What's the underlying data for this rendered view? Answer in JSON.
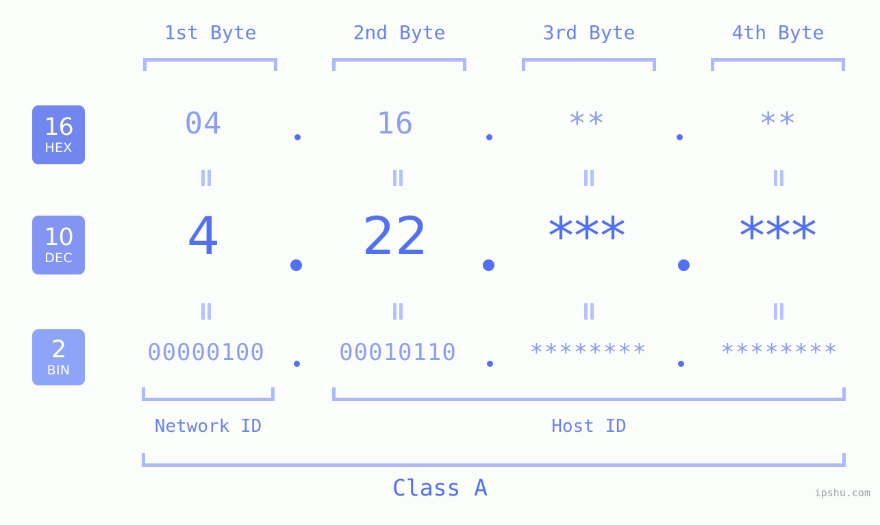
{
  "byte_headers": [
    "1st Byte",
    "2nd Byte",
    "3rd Byte",
    "4th Byte"
  ],
  "radix_rows": [
    {
      "base": "16",
      "name": "HEX",
      "badge_color": "#7186ee",
      "values": [
        "04",
        "16",
        "**",
        "**"
      ]
    },
    {
      "base": "10",
      "name": "DEC",
      "badge_color": "#8295f2",
      "values": [
        "4",
        "22",
        "***",
        "***"
      ]
    },
    {
      "base": "2",
      "name": "BIN",
      "badge_color": "#8ea5f7",
      "values": [
        "00000100",
        "00010110",
        "********",
        "********"
      ]
    }
  ],
  "separator": ".",
  "equals_sign": "=",
  "segments": {
    "network_id": "Network ID",
    "host_id": "Host ID"
  },
  "class_label": "Class A",
  "watermark": "ipshu.com",
  "colors": {
    "background": "#fbfdfa",
    "accent_strong": "#5271f2",
    "accent_mid": "#6c82f0",
    "accent_light": "#8e9ef0",
    "bracket": "#aeb9fb",
    "connector": "#b7c1fb",
    "watermark": "#9aa0a6"
  }
}
